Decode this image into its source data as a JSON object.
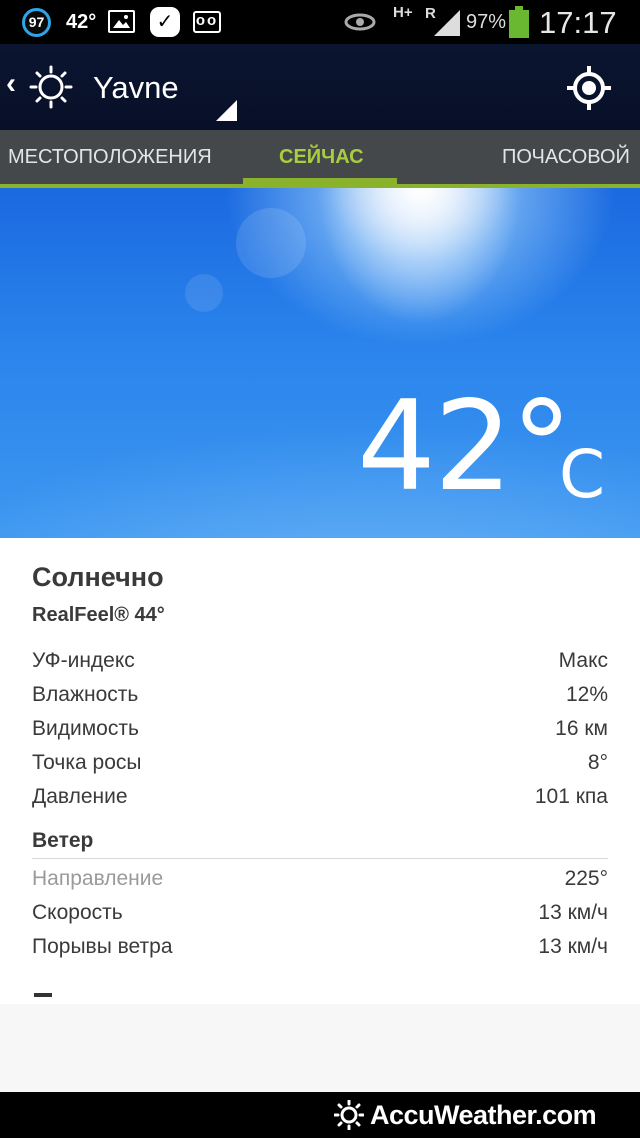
{
  "status_bar": {
    "badge_number": "97",
    "temperature": "42°",
    "network": "H+",
    "roaming": "R",
    "battery_percent": "97%",
    "time": "17:17",
    "icons": [
      "gallery-icon",
      "check-icon",
      "voicemail-icon",
      "eye-icon",
      "signal-icon",
      "battery-icon"
    ]
  },
  "header": {
    "city": "Yavne",
    "icons": [
      "back-icon",
      "sun-icon",
      "dropdown-icon",
      "locate-icon"
    ]
  },
  "tabs": [
    {
      "label": "МЕСТОПОЛОЖЕНИЯ",
      "active": false
    },
    {
      "label": "СЕЙЧАС",
      "active": true
    },
    {
      "label": "ПОЧАСОВОЙ",
      "active": false
    }
  ],
  "current": {
    "temperature": "42°",
    "unit": "C",
    "condition": "Солнечно",
    "realfeel": "RealFeel® 44°"
  },
  "details": [
    {
      "label": "УФ-индекс",
      "value": "Макс"
    },
    {
      "label": "Влажность",
      "value": "12%"
    },
    {
      "label": "Видимость",
      "value": "16 км"
    },
    {
      "label": "Точка росы",
      "value": "8°"
    },
    {
      "label": "Давление",
      "value": "101 кпа"
    }
  ],
  "wind": {
    "title": "Ветер",
    "rows": [
      {
        "label": "Направление",
        "value": "225°"
      },
      {
        "label": "Скорость",
        "value": "13 км/ч"
      },
      {
        "label": "Порывы ветра",
        "value": "13 км/ч"
      }
    ]
  },
  "footer": {
    "brand": "AccuWeather.com"
  },
  "colors": {
    "accent": "#8bb22d",
    "active_tab_text": "#a9cd3f",
    "tab_bar": "#45484b",
    "action_bar": "#0b1530",
    "sky": "#2a84ec"
  }
}
